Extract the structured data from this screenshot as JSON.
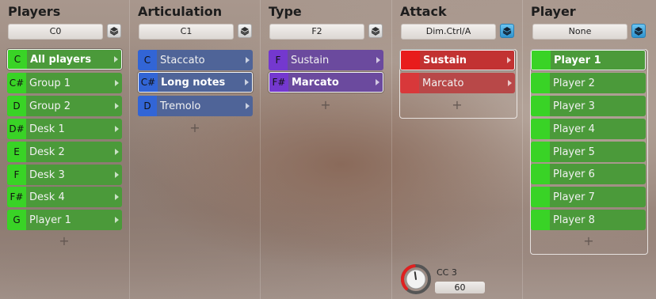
{
  "columns": [
    {
      "title": "Players",
      "selector": "C0",
      "stack_active": false
    },
    {
      "title": "Articulation",
      "selector": "C1",
      "stack_active": false
    },
    {
      "title": "Type",
      "selector": "F2",
      "stack_active": false
    },
    {
      "title": "Attack",
      "selector": "Dim.Ctrl/A",
      "stack_active": true
    },
    {
      "title": "Player",
      "selector": "None",
      "stack_active": true
    }
  ],
  "players_list": [
    {
      "key": "C",
      "label": "All players",
      "selected": true
    },
    {
      "key": "C#",
      "label": "Group 1"
    },
    {
      "key": "D",
      "label": "Group 2"
    },
    {
      "key": "D#",
      "label": "Desk 1"
    },
    {
      "key": "E",
      "label": "Desk 2"
    },
    {
      "key": "F",
      "label": "Desk 3"
    },
    {
      "key": "F#",
      "label": "Desk 4"
    },
    {
      "key": "G",
      "label": "Player 1"
    }
  ],
  "articulation_list": [
    {
      "key": "C",
      "label": "Staccato"
    },
    {
      "key": "C#",
      "label": "Long notes",
      "selected": true
    },
    {
      "key": "D",
      "label": "Tremolo"
    }
  ],
  "type_list": [
    {
      "key": "F",
      "label": "Sustain"
    },
    {
      "key": "F#",
      "label": "Marcato",
      "selected": true
    }
  ],
  "attack_list": [
    {
      "label": "Sustain",
      "selected": true
    },
    {
      "label": "Marcato"
    }
  ],
  "player_list": [
    {
      "label": "Player 1",
      "selected": true
    },
    {
      "label": "Player 2"
    },
    {
      "label": "Player 3"
    },
    {
      "label": "Player 4"
    },
    {
      "label": "Player 5"
    },
    {
      "label": "Player 6"
    },
    {
      "label": "Player 7"
    },
    {
      "label": "Player 8"
    }
  ],
  "add_symbol": "+",
  "controller": {
    "label": "CC 3",
    "value": "60",
    "level": 0.47
  }
}
